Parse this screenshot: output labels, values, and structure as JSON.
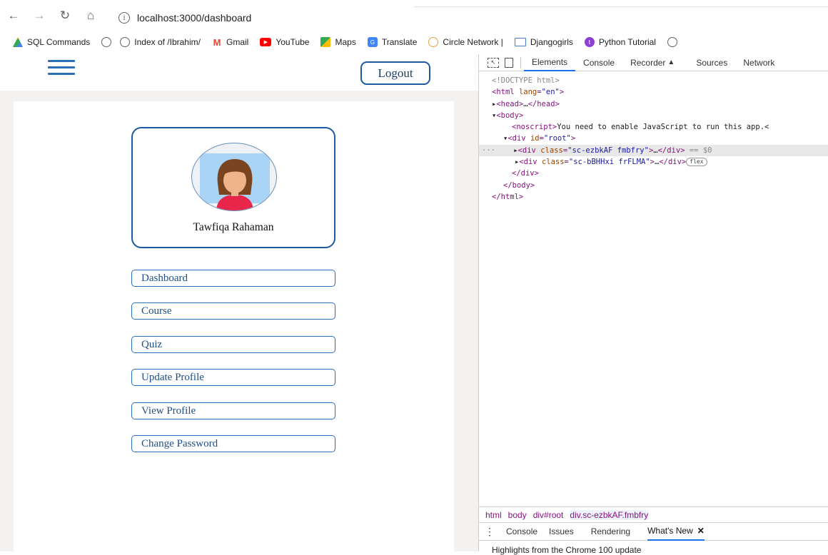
{
  "browser": {
    "url": "localhost:3000/dashboard",
    "bookmarks": [
      "SQL Commands",
      "Index of /Ibrahim/",
      "Gmail",
      "YouTube",
      "Maps",
      "Translate",
      "Circle Network |",
      "Djangogirls",
      "Python Tutorial"
    ]
  },
  "app": {
    "logout_label": "Logout",
    "user_name": "Tawfiqa Rahaman",
    "menu": [
      "Dashboard",
      "Course",
      "Quiz",
      "Update Profile",
      "View Profile",
      "Change Password"
    ]
  },
  "devtools": {
    "tabs": [
      "Elements",
      "Console",
      "Recorder",
      "Sources",
      "Network"
    ],
    "crumbs": [
      "html",
      "body",
      "div#root",
      "div.sc-ezbkAF.fmbfry"
    ],
    "drawer_tabs": [
      "Console",
      "Issues",
      "Rendering",
      "What's New"
    ],
    "drawer_text": "Highlights from the Chrome 100 update",
    "code": {
      "doctype": "<!DOCTYPE html>",
      "noscript_text": "You need to enable JavaScript to run this app.<",
      "selected_suffix": "== $0",
      "flex_badge": "flex"
    }
  },
  "colors": {
    "accent": "#1e5aa0",
    "devtools_blue": "#1a73e8"
  }
}
